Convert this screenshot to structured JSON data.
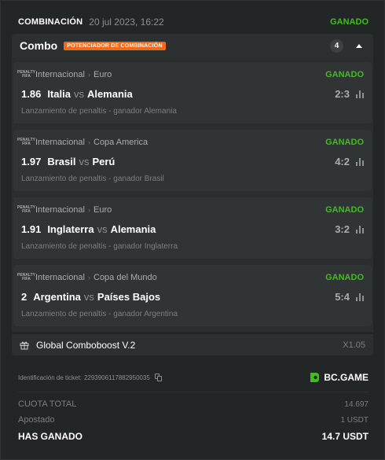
{
  "header": {
    "type": "COMBINACIÓN",
    "date": "20 jul 2023, 16:22",
    "status": "GANADO"
  },
  "combo": {
    "label": "Combo",
    "badge": "POTENCIADOR DE COMBINACIÓN",
    "count": "4"
  },
  "legs": [
    {
      "icon": "fifa-icon",
      "sport": "Internacional",
      "competition": "Euro",
      "status": "GANADO",
      "odds": "1.86",
      "home": "Italia",
      "vs": "vs",
      "away": "Alemania",
      "score": "2:3",
      "pick": "Lanzamiento de penaltis - ganador Alemania"
    },
    {
      "icon": "fifa-icon",
      "sport": "Internacional",
      "competition": "Copa America",
      "status": "GANADO",
      "odds": "1.97",
      "home": "Brasil",
      "vs": "vs",
      "away": "Perú",
      "score": "4:2",
      "pick": "Lanzamiento de penaltis - ganador Brasil"
    },
    {
      "icon": "fifa-icon",
      "sport": "Internacional",
      "competition": "Euro",
      "status": "GANADO",
      "odds": "1.91",
      "home": "Inglaterra",
      "vs": "vs",
      "away": "Alemania",
      "score": "3:2",
      "pick": "Lanzamiento de penaltis - ganador Inglaterra"
    },
    {
      "icon": "fifa-icon",
      "sport": "Internacional",
      "competition": "Copa del Mundo",
      "status": "GANADO",
      "odds": "2",
      "home": "Argentina",
      "vs": "vs",
      "away": "Países Bajos",
      "score": "5:4",
      "pick": "Lanzamiento de penaltis - ganador Argentina"
    }
  ],
  "boost": {
    "icon": "gift-icon",
    "name": "Global Comboboost V.2",
    "value": "X1.05"
  },
  "ticket": {
    "label": "Identificación de ticket:",
    "id": "2293906117882950035"
  },
  "brand": {
    "logo_text": "BC.GAME"
  },
  "summary": {
    "total_odds_label": "CUOTA TOTAL",
    "total_odds": "14.697",
    "staked_label": "Apostado",
    "staked": "1 USDT",
    "won_label": "HAS GANADO",
    "won": "14.7 USDT"
  },
  "colors": {
    "background": "#232626",
    "win": "#3bc117",
    "badge": "#ee6a1c",
    "muted": "#7a7f80"
  }
}
